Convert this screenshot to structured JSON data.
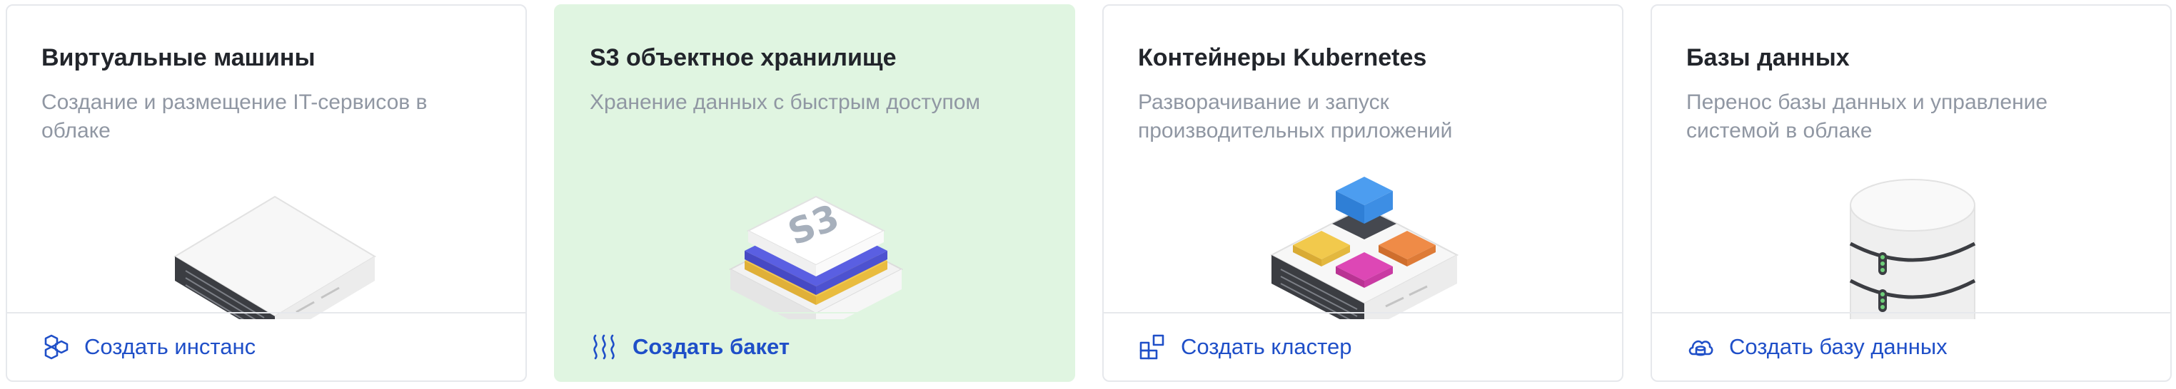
{
  "cards": [
    {
      "title": "Виртуальные машины",
      "description": "Создание и размещение IT-сервисов в облаке",
      "action_label": "Создать инстанс",
      "action_icon": "hexagon-cluster-icon",
      "illustration": "server-icon"
    },
    {
      "title": "S3 объектное хранилище",
      "description": "Хранение данных с быстрым доступом",
      "action_label": "Создать бакет",
      "action_icon": "waves-icon",
      "illustration": "s3-storage-icon",
      "illustration_text": "S3",
      "active": true
    },
    {
      "title": "Контейнеры Kubernetes",
      "description": "Разворачивание и запуск производительных приложений",
      "action_label": "Создать кластер",
      "action_icon": "cluster-grid-icon",
      "illustration": "kubernetes-containers-icon"
    },
    {
      "title": "Базы данных",
      "description": "Перенос базы данных и управление системой в облаке",
      "action_label": "Создать базу данных",
      "action_icon": "database-cloud-icon",
      "illustration": "database-icon"
    }
  ],
  "colors": {
    "accent_link": "#1f4fc8",
    "active_card_bg": "#e0f5e1",
    "title_text": "#22252b",
    "description_text": "#9097a3",
    "border": "#e6e8ec"
  }
}
